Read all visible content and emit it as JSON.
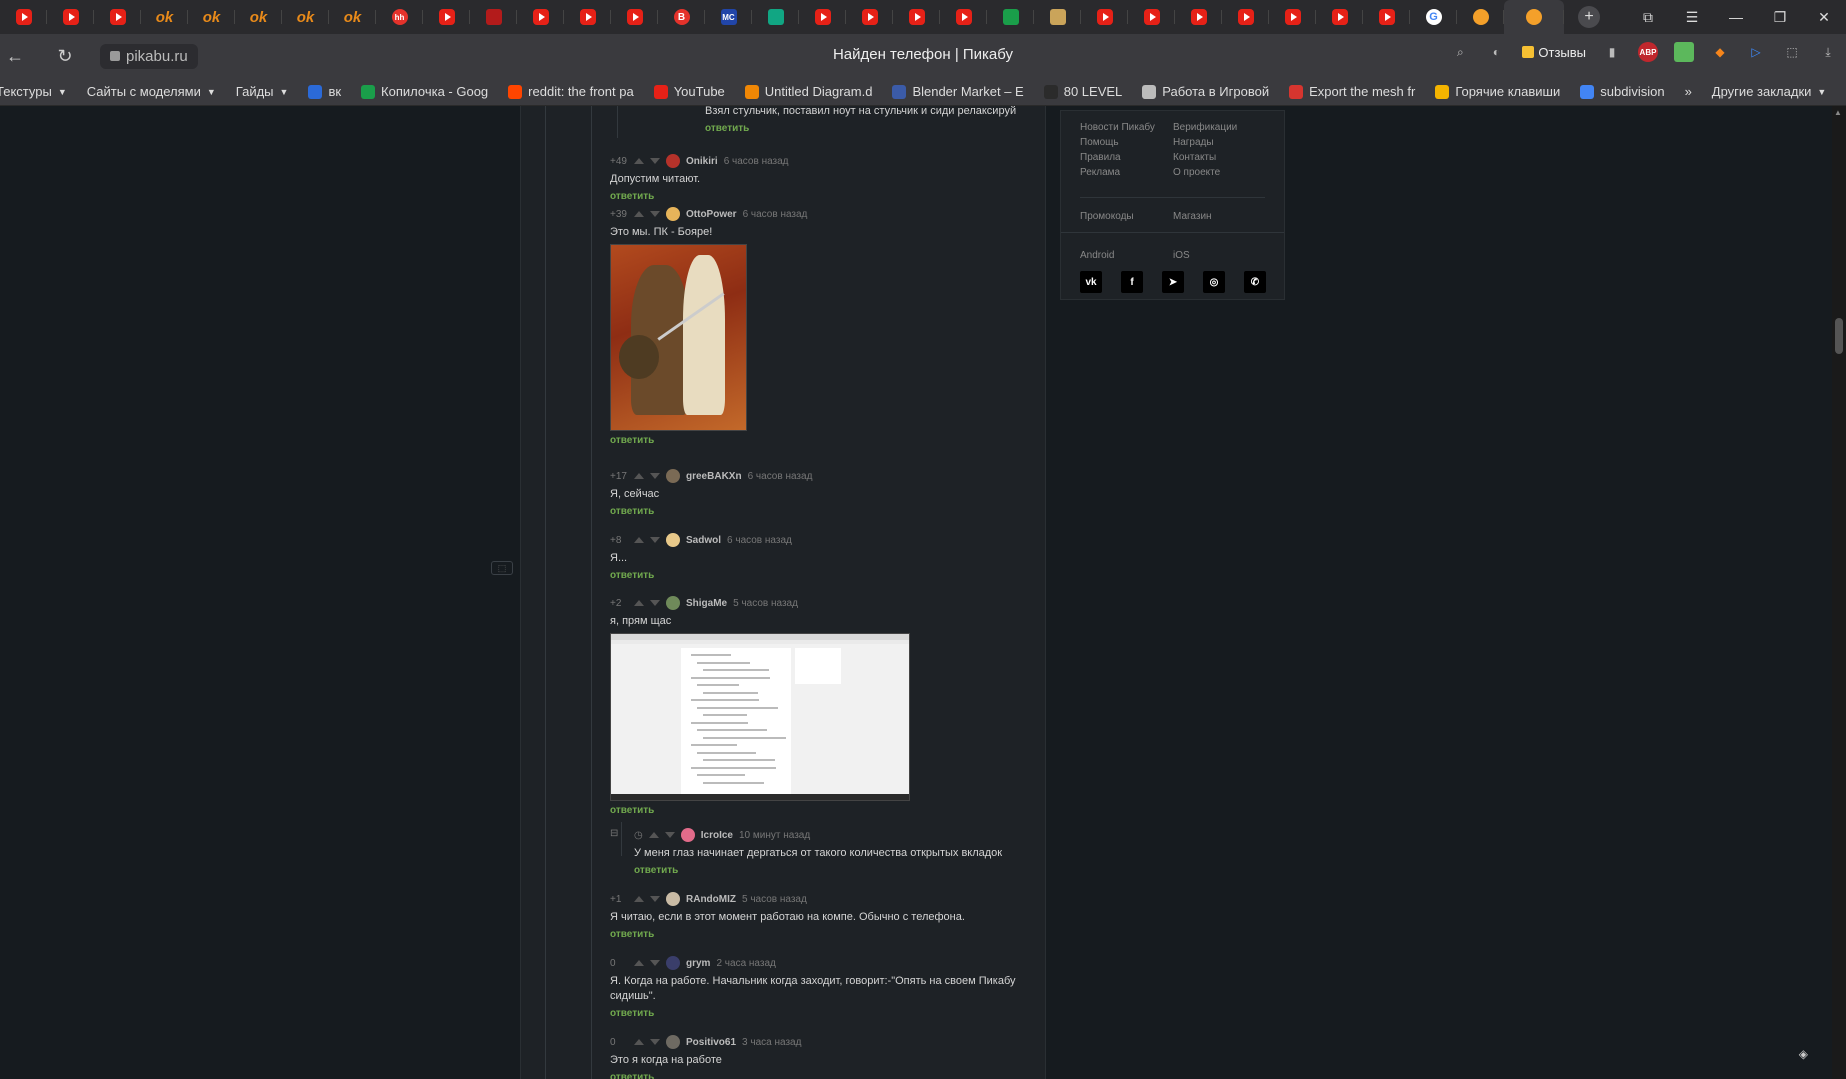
{
  "browser": {
    "page_title": "Найден телефон | Пикабу",
    "url": "pikabu.ru",
    "reviews_label": "Отзывы",
    "abp_label": "ABP",
    "tabs": [
      {
        "icon": "youtube-icon",
        "label": ""
      },
      {
        "icon": "youtube-icon",
        "label": ""
      },
      {
        "icon": "youtube-icon",
        "label": ""
      },
      {
        "icon": "odnoklassniki-icon",
        "label": "ok"
      },
      {
        "icon": "odnoklassniki-icon",
        "label": "ok"
      },
      {
        "icon": "odnoklassniki-icon",
        "label": "ok"
      },
      {
        "icon": "odnoklassniki-icon",
        "label": "ok"
      },
      {
        "icon": "odnoklassniki-icon",
        "label": "ok"
      },
      {
        "icon": "hh-icon",
        "label": "hh"
      },
      {
        "icon": "youtube-icon",
        "label": ""
      },
      {
        "icon": "red-square-icon",
        "label": ""
      },
      {
        "icon": "youtube-icon",
        "label": ""
      },
      {
        "icon": "youtube-icon",
        "label": ""
      },
      {
        "icon": "youtube-icon",
        "label": ""
      },
      {
        "icon": "bitrix-icon",
        "label": "B"
      },
      {
        "icon": "mc-icon",
        "label": "MC"
      },
      {
        "icon": "green-chart-icon",
        "label": ""
      },
      {
        "icon": "youtube-icon",
        "label": ""
      },
      {
        "icon": "youtube-icon",
        "label": ""
      },
      {
        "icon": "youtube-icon",
        "label": ""
      },
      {
        "icon": "youtube-icon",
        "label": ""
      },
      {
        "icon": "sheets-icon",
        "label": ""
      },
      {
        "icon": "image-icon",
        "label": ""
      },
      {
        "icon": "youtube-icon",
        "label": ""
      },
      {
        "icon": "youtube-icon",
        "label": ""
      },
      {
        "icon": "youtube-icon",
        "label": ""
      },
      {
        "icon": "youtube-icon",
        "label": ""
      },
      {
        "icon": "youtube-icon",
        "label": ""
      },
      {
        "icon": "youtube-icon",
        "label": ""
      },
      {
        "icon": "youtube-icon",
        "label": ""
      },
      {
        "icon": "google-icon",
        "label": "G"
      },
      {
        "icon": "pikabu-icon",
        "label": ""
      }
    ],
    "active_tab_icon": "pikabu-icon",
    "bookmarks": [
      {
        "label": "Текстуры",
        "dropdown": true,
        "icon": ""
      },
      {
        "label": "Сайты с моделями",
        "dropdown": true,
        "icon": ""
      },
      {
        "label": "Гайды",
        "dropdown": true,
        "icon": ""
      },
      {
        "label": "вк",
        "dropdown": false,
        "icon": "#2b6ad8"
      },
      {
        "label": "Копилочка - Goog",
        "dropdown": false,
        "icon": "#1a9e4a"
      },
      {
        "label": "reddit: the front pa",
        "dropdown": false,
        "icon": "#ff4500"
      },
      {
        "label": "YouTube",
        "dropdown": false,
        "icon": "#e62117"
      },
      {
        "label": "Untitled Diagram.d",
        "dropdown": false,
        "icon": "#f08705"
      },
      {
        "label": "Blender Market – E",
        "dropdown": false,
        "icon": "#3b5ba8"
      },
      {
        "label": "80 LEVEL",
        "dropdown": false,
        "icon": "#2b2b2b"
      },
      {
        "label": "Работа в Игровой",
        "dropdown": false,
        "icon": "#bbbbbb"
      },
      {
        "label": "Export the mesh fr",
        "dropdown": false,
        "icon": "#d6352f"
      },
      {
        "label": "Горячие клавиши",
        "dropdown": false,
        "icon": "#f4b400"
      },
      {
        "label": "subdivision",
        "dropdown": false,
        "icon": "#4285f4"
      }
    ],
    "other_bookmarks": "Другие закладки",
    "more_chevron": "»"
  },
  "comments": {
    "reply_label": "ответить",
    "items": [
      {
        "rating": "",
        "user": "",
        "time": "",
        "text": "Взял стульчик, поставил ноут на стульчик и сиди релаксируй",
        "avatar_color": "#777777"
      },
      {
        "rating": "+49",
        "user": "Onikiri",
        "time": "6 часов назад",
        "text": "Допустим читают.",
        "avatar_color": "#b5322a"
      },
      {
        "rating": "+39",
        "user": "OttoPower",
        "time": "6 часов назад",
        "text": "Это мы. ПК - Бояре!",
        "avatar_color": "#e6b45a"
      },
      {
        "rating": "+17",
        "user": "greeBAKXn",
        "time": "6 часов назад",
        "text": "Я, сейчас",
        "avatar_color": "#7a6a55"
      },
      {
        "rating": "+8",
        "user": "Sadwol",
        "time": "6 часов назад",
        "text": "Я...",
        "avatar_color": "#e8c98a"
      },
      {
        "rating": "+2",
        "user": "ShigaMe",
        "time": "5 часов назад",
        "text": "я, прям щас",
        "avatar_color": "#6f8a5a"
      },
      {
        "rating": "",
        "user": "IcroIce",
        "time": "10 минут назад",
        "text": "У меня глаз начинает дергаться от такого количества открытых вкладок",
        "avatar_color": "#e26b8a"
      },
      {
        "rating": "+1",
        "user": "RAndoMIZ",
        "time": "5 часов назад",
        "text": "Я читаю, если в этот момент работаю на компе. Обычно с телефона.",
        "avatar_color": "#c9bba5"
      },
      {
        "rating": "0",
        "user": "grym",
        "time": "2 часа назад",
        "text": "Я. Когда на работе. Начальник когда заходит, говорит:-\"Опять на своем Пикабу сидишь\".",
        "avatar_color": "#3a3e6a"
      },
      {
        "rating": "0",
        "user": "Positivo61",
        "time": "3 часа назад",
        "text": "Это я когда на работе",
        "avatar_color": "#6e6a62"
      }
    ]
  },
  "sidebar": {
    "links": [
      "Новости Пикабу",
      "Верификации",
      "Помощь",
      "Награды",
      "Правила",
      "Контакты",
      "Реклама",
      "О проекте"
    ],
    "promo": [
      "Промокоды",
      "Магазин"
    ],
    "apps": [
      "Android",
      "iOS"
    ],
    "socials": [
      {
        "name": "vk-icon",
        "glyph": "vk"
      },
      {
        "name": "facebook-icon",
        "glyph": "f"
      },
      {
        "name": "telegram-icon",
        "glyph": "➤"
      },
      {
        "name": "instagram-icon",
        "glyph": "◎"
      },
      {
        "name": "viber-icon",
        "glyph": "✆"
      }
    ]
  }
}
